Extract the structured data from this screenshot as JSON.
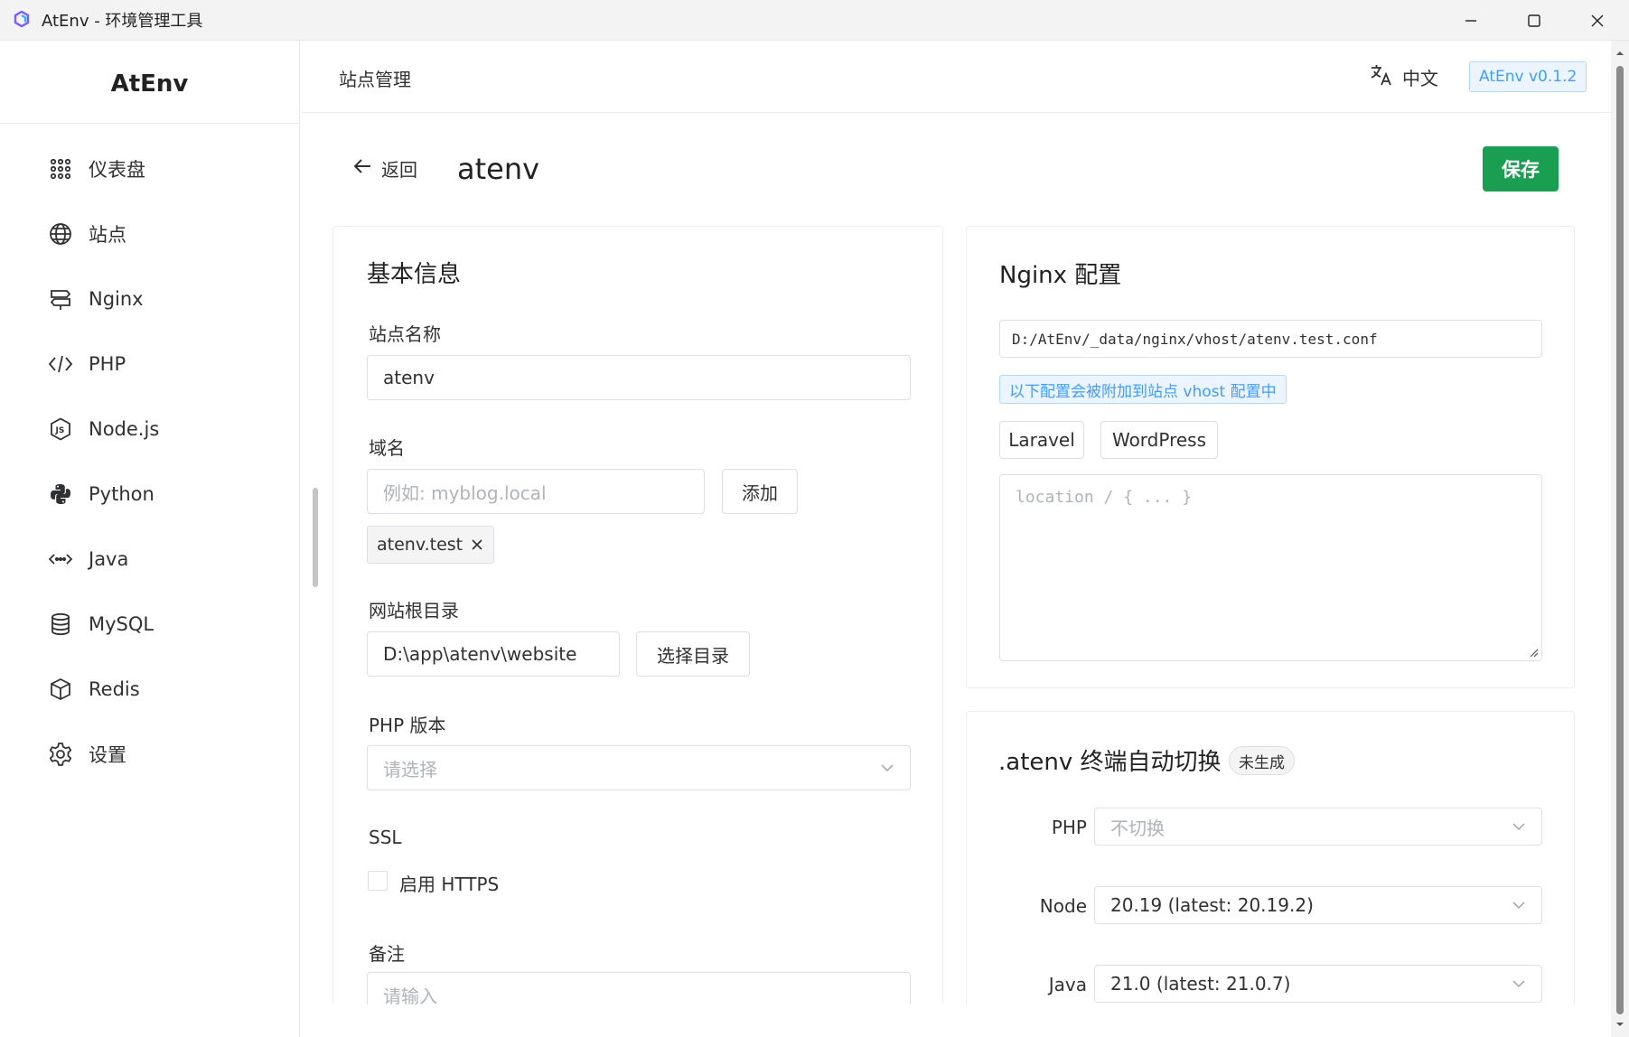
{
  "window": {
    "title": "AtEnv - 环境管理工具"
  },
  "sidebar": {
    "brand": "AtEnv",
    "items": [
      {
        "label": "仪表盘",
        "icon": "grid-icon"
      },
      {
        "label": "站点",
        "icon": "globe-icon"
      },
      {
        "label": "Nginx",
        "icon": "signpost-icon"
      },
      {
        "label": "PHP",
        "icon": "code-icon"
      },
      {
        "label": "Node.js",
        "icon": "nodejs-icon"
      },
      {
        "label": "Python",
        "icon": "python-icon"
      },
      {
        "label": "Java",
        "icon": "java-icon"
      },
      {
        "label": "MySQL",
        "icon": "database-icon"
      },
      {
        "label": "Redis",
        "icon": "cube-icon"
      },
      {
        "label": "设置",
        "icon": "gear-icon"
      }
    ]
  },
  "header": {
    "breadcrumb": "站点管理",
    "language": "中文",
    "version": "AtEnv v0.1.2"
  },
  "page": {
    "back_label": "返回",
    "title": "atenv",
    "save_label": "保存"
  },
  "basic": {
    "title": "基本信息",
    "site_name_label": "站点名称",
    "site_name_value": "atenv",
    "domain_label": "域名",
    "domain_placeholder": "例如: myblog.local",
    "add_label": "添加",
    "domains": [
      "atenv.test"
    ],
    "root_label": "网站根目录",
    "root_value": "D:\\app\\atenv\\website",
    "choose_dir_label": "选择目录",
    "php_label": "PHP 版本",
    "php_placeholder": "请选择",
    "ssl_label": "SSL",
    "https_label": "启用 HTTPS",
    "note_label": "备注",
    "note_placeholder": "请输入"
  },
  "nginx": {
    "title": "Nginx 配置",
    "conf_path": "D:/AtEnv/_data/nginx/vhost/atenv.test.conf",
    "info": "以下配置会被附加到站点 vhost 配置中",
    "preset_laravel": "Laravel",
    "preset_wordpress": "WordPress",
    "textarea_placeholder": "location / { ... }"
  },
  "terminal": {
    "title": ".atenv 终端自动切换",
    "status": "未生成",
    "php_label": "PHP",
    "php_value": "不切换",
    "node_label": "Node",
    "node_value": "20.19 (latest: 20.19.2)",
    "java_label": "Java",
    "java_value": "21.0 (latest: 21.0.7)"
  },
  "colors": {
    "accent_green": "#1a9f52",
    "info_blue": "#409eff"
  }
}
